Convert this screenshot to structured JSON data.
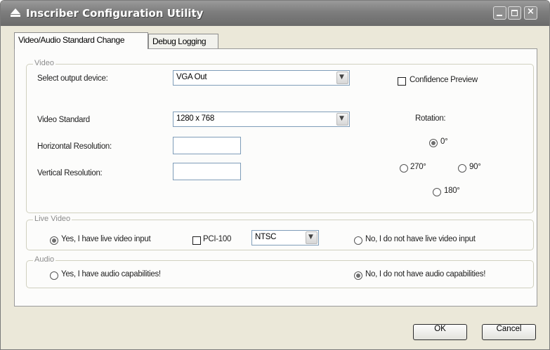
{
  "window": {
    "title": "Inscriber Configuration Utility",
    "controls": {
      "minimize": "minimize-icon",
      "maximize": "maximize-icon",
      "close": "×"
    }
  },
  "tabs": [
    {
      "label": "Video/Audio Standard Change",
      "active": true
    },
    {
      "label": "Debug Logging",
      "active": false
    }
  ],
  "video": {
    "legend": "Video",
    "output_device_label": "Select output device:",
    "output_device_value": "VGA Out",
    "confidence_preview_label": "Confidence Preview",
    "confidence_preview_checked": false,
    "video_standard_label": "Video Standard",
    "video_standard_value": "1280 x 768",
    "horizontal_resolution_label": "Horizontal Resolution:",
    "horizontal_resolution_value": "",
    "vertical_resolution_label": "Vertical Resolution:",
    "vertical_resolution_value": "",
    "rotation_label": "Rotation:",
    "rotation_options": [
      "0°",
      "270°",
      "90°",
      "180°"
    ],
    "rotation_selected": "0°"
  },
  "live_video": {
    "legend": "Live Video",
    "yes_label": "Yes, I have live video input",
    "yes_selected": true,
    "pci_label": "PCI-100",
    "pci_checked": false,
    "format_value": "NTSC",
    "no_label": "No, I do not have live video input"
  },
  "audio": {
    "legend": "Audio",
    "yes_label": "Yes, I have audio capabilities!",
    "no_label": "No, I do not have audio capabilities!",
    "no_selected": true
  },
  "buttons": {
    "ok": "OK",
    "cancel": "Cancel"
  },
  "icons": {
    "dropdown": "▼"
  }
}
